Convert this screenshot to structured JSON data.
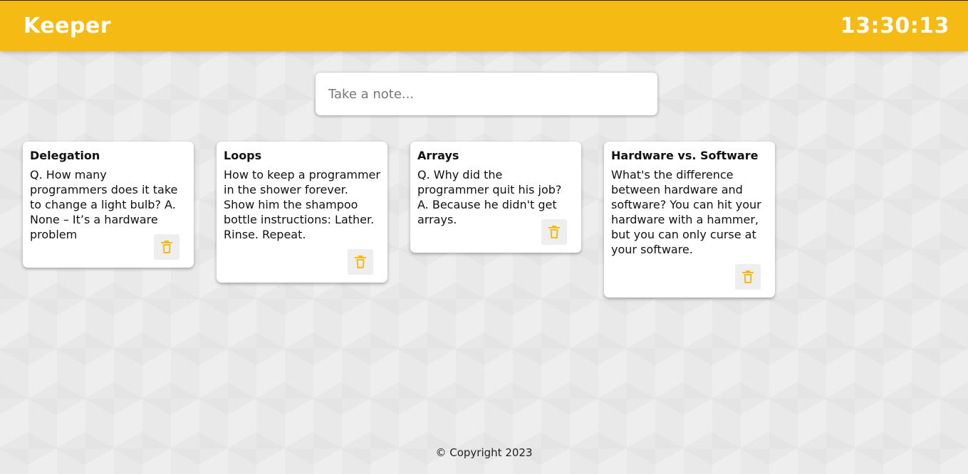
{
  "header": {
    "app_title": "Keeper",
    "clock": "13:30:13"
  },
  "create_note": {
    "placeholder": "Take a note..."
  },
  "notes": [
    {
      "title": "Delegation",
      "content": "Q. How many programmers does it take to change a light bulb? A. None – It’s a hardware problem",
      "delete_icon": "trash-icon"
    },
    {
      "title": "Loops",
      "content": "How to keep a programmer in the shower forever. Show him the shampoo bottle instructions: Lather. Rinse. Repeat.",
      "delete_icon": "trash-icon"
    },
    {
      "title": "Arrays",
      "content": "Q. Why did the programmer quit his job? A. Because he didn't get arrays.",
      "delete_icon": "trash-icon"
    },
    {
      "title": "Hardware vs. Software",
      "content": "What's the difference between hardware and software? You can hit your hardware with a hammer, but you can only curse at your software.",
      "delete_icon": "trash-icon"
    }
  ],
  "footer": {
    "copyright": "© Copyright 2023"
  },
  "colors": {
    "accent": "#f5ba13",
    "background": "#eeeeee",
    "card": "#ffffff"
  }
}
